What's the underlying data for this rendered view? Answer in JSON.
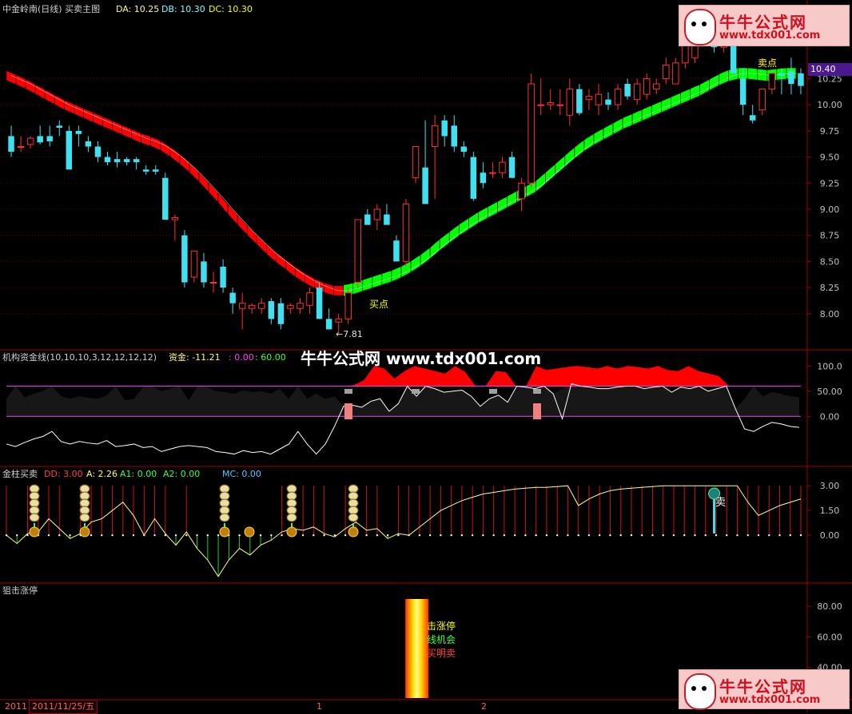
{
  "header": {
    "title": "中金岭南(日线) 买卖主图",
    "da": "DA: 10.25",
    "db": "DB: 10.30",
    "dc": "DC: 10.30"
  },
  "watermark": "牛牛公式网 www.tdx001.com",
  "logo": {
    "title": "牛牛公式网",
    "url": "www.tdx001.com"
  },
  "colors": {
    "up": "#ff3030",
    "down": "#40e0f0",
    "red_band": "#ff0000",
    "green_band": "#00ff00",
    "grid": "#800000",
    "axis_text": "#c0c0c0"
  },
  "annotations": {
    "buy": "买点",
    "sell": "卖点",
    "low": "←7.81"
  },
  "current_price": "10.40",
  "panel2": {
    "title": "机构资金线(10,10,10,3,12,12,12,12)",
    "fund": "资金: -11.21",
    "v1": ": 0.00",
    "v2": ": 60.00"
  },
  "panel3": {
    "title": "金柱买卖",
    "dd": "DD: 3.00",
    "a": "A: 2.26",
    "a1": "A1: 0.00",
    "a2": "A2: 0.00",
    "mc": "MC: 0.00",
    "sell_mark": "卖"
  },
  "panel4": {
    "title": "狙击涨停",
    "line1": "击涨停",
    "line2": "线机会",
    "line3": "买明卖"
  },
  "bottom": {
    "year": "2011",
    "date": "2011/11/25/五",
    "tick1": "1",
    "tick2": "2"
  },
  "chart_data": [
    {
      "type": "candlestick",
      "title": "中金岭南(日线) 买卖主图",
      "ylim": [
        7.7,
        10.85
      ],
      "yticks": [
        "10.25",
        "10.00",
        "9.75",
        "9.50",
        "9.25",
        "9.00",
        "8.75",
        "8.50",
        "8.25",
        "8.00"
      ],
      "candles": [
        [
          9.7,
          9.8,
          9.5,
          9.55
        ],
        [
          9.6,
          9.7,
          9.55,
          9.6
        ],
        [
          9.62,
          9.7,
          9.58,
          9.68
        ],
        [
          9.7,
          9.8,
          9.62,
          9.64
        ],
        [
          9.7,
          9.8,
          9.6,
          9.65
        ],
        [
          9.8,
          9.85,
          9.7,
          9.78
        ],
        [
          9.75,
          9.8,
          9.4,
          9.38
        ],
        [
          9.75,
          9.8,
          9.6,
          9.72
        ],
        [
          9.65,
          9.7,
          9.55,
          9.6
        ],
        [
          9.6,
          9.65,
          9.45,
          9.5
        ],
        [
          9.5,
          9.55,
          9.42,
          9.45
        ],
        [
          9.48,
          9.55,
          9.4,
          9.45
        ],
        [
          9.48,
          9.5,
          9.42,
          9.45
        ],
        [
          9.48,
          9.5,
          9.38,
          9.45
        ],
        [
          9.38,
          9.42,
          9.33,
          9.36
        ],
        [
          9.38,
          9.42,
          9.33,
          9.36
        ],
        [
          9.3,
          9.35,
          8.9,
          8.9
        ],
        [
          8.9,
          8.95,
          8.7,
          8.92
        ],
        [
          8.75,
          8.8,
          8.25,
          8.3
        ],
        [
          8.35,
          8.6,
          8.3,
          8.6
        ],
        [
          8.5,
          8.58,
          8.25,
          8.3
        ],
        [
          8.3,
          8.4,
          8.2,
          8.3
        ],
        [
          8.45,
          8.52,
          8.2,
          8.25
        ],
        [
          8.2,
          8.25,
          8.0,
          8.1
        ],
        [
          8.05,
          8.2,
          7.85,
          8.1
        ],
        [
          8.05,
          8.1,
          8.0,
          8.08
        ],
        [
          8.05,
          8.15,
          8.0,
          8.1
        ],
        [
          8.12,
          8.15,
          7.9,
          7.95
        ],
        [
          8.1,
          8.15,
          7.85,
          7.9
        ],
        [
          8.05,
          8.1,
          8.0,
          8.08
        ],
        [
          8.05,
          8.15,
          8.0,
          8.1
        ],
        [
          8.08,
          8.25,
          8.0,
          8.2
        ],
        [
          8.25,
          8.3,
          7.95,
          7.95
        ],
        [
          7.95,
          8.05,
          7.85,
          7.85
        ],
        [
          7.92,
          8.0,
          7.81,
          7.95
        ],
        [
          7.95,
          8.25,
          7.9,
          8.2
        ],
        [
          8.3,
          8.9,
          8.25,
          8.9
        ],
        [
          8.95,
          9.0,
          8.85,
          8.85
        ],
        [
          8.9,
          9.05,
          8.8,
          9.0
        ],
        [
          8.95,
          9.05,
          8.85,
          8.85
        ],
        [
          8.7,
          8.75,
          8.5,
          8.5
        ],
        [
          8.5,
          9.1,
          8.45,
          9.05
        ],
        [
          9.3,
          9.6,
          9.25,
          9.6
        ],
        [
          9.4,
          9.85,
          9.05,
          9.05
        ],
        [
          9.6,
          9.9,
          9.1,
          9.8
        ],
        [
          9.85,
          9.9,
          9.6,
          9.7
        ],
        [
          9.8,
          9.9,
          9.55,
          9.6
        ],
        [
          9.6,
          9.65,
          9.5,
          9.55
        ],
        [
          9.5,
          9.55,
          9.08,
          9.1
        ],
        [
          9.35,
          9.45,
          9.2,
          9.25
        ],
        [
          9.35,
          9.45,
          9.3,
          9.35
        ],
        [
          9.35,
          9.5,
          9.3,
          9.45
        ],
        [
          9.5,
          9.55,
          9.3,
          9.3
        ],
        [
          9.1,
          9.3,
          8.98,
          9.25
        ],
        [
          9.25,
          10.3,
          9.2,
          10.2
        ],
        [
          10.0,
          10.25,
          9.9,
          10.0
        ],
        [
          10.0,
          10.15,
          9.95,
          10.02
        ],
        [
          10.0,
          10.15,
          9.9,
          10.0
        ],
        [
          9.9,
          10.25,
          9.8,
          10.15
        ],
        [
          10.15,
          10.2,
          9.9,
          9.92
        ],
        [
          10.05,
          10.15,
          9.95,
          10.08
        ],
        [
          10.0,
          10.2,
          9.9,
          10.1
        ],
        [
          10.05,
          10.12,
          9.95,
          10.0
        ],
        [
          10.0,
          10.2,
          9.95,
          10.15
        ],
        [
          10.2,
          10.25,
          10.05,
          10.08
        ],
        [
          10.05,
          10.25,
          10.0,
          10.2
        ],
        [
          10.1,
          10.3,
          10.05,
          10.25
        ],
        [
          10.15,
          10.25,
          10.1,
          10.2
        ],
        [
          10.25,
          10.45,
          10.2,
          10.38
        ],
        [
          10.2,
          10.45,
          10.2,
          10.4
        ],
        [
          10.4,
          10.75,
          10.35,
          10.7
        ],
        [
          10.45,
          10.75,
          10.4,
          10.7
        ],
        [
          10.75,
          10.85,
          10.7,
          10.7
        ],
        [
          10.7,
          10.8,
          10.5,
          10.55
        ],
        [
          10.55,
          10.85,
          10.5,
          10.75
        ],
        [
          10.7,
          10.78,
          10.3,
          10.3
        ],
        [
          10.25,
          10.35,
          9.9,
          10.0
        ],
        [
          9.9,
          10.0,
          9.82,
          9.85
        ],
        [
          9.95,
          10.15,
          9.9,
          10.15
        ],
        [
          10.15,
          10.3,
          10.1,
          10.3
        ],
        [
          10.3,
          10.35,
          10.1,
          10.28
        ],
        [
          10.32,
          10.45,
          10.1,
          10.2
        ],
        [
          10.3,
          10.35,
          10.1,
          10.18
        ]
      ],
      "ma_band": [
        10.28,
        10.24,
        10.2,
        10.15,
        10.1,
        10.05,
        10.0,
        9.96,
        9.92,
        9.88,
        9.84,
        9.8,
        9.76,
        9.72,
        9.68,
        9.65,
        9.61,
        9.55,
        9.48,
        9.4,
        9.31,
        9.21,
        9.11,
        9.0,
        8.9,
        8.8,
        8.71,
        8.62,
        8.54,
        8.47,
        8.4,
        8.34,
        8.29,
        8.25,
        8.22,
        8.22,
        8.24,
        8.27,
        8.3,
        8.33,
        8.36,
        8.4,
        8.45,
        8.51,
        8.58,
        8.66,
        8.73,
        8.8,
        8.86,
        8.92,
        8.97,
        9.02,
        9.07,
        9.12,
        9.17,
        9.22,
        9.3,
        9.38,
        9.46,
        9.54,
        9.61,
        9.67,
        9.72,
        9.77,
        9.82,
        9.86,
        9.9,
        9.94,
        9.98,
        10.02,
        10.06,
        10.1,
        10.14,
        10.19,
        10.24,
        10.28,
        10.3,
        10.3,
        10.29,
        10.28,
        10.29,
        10.3,
        10.3
      ],
      "band_color_switch_index": 35
    },
    {
      "type": "line",
      "title": "机构资金线(10,10,10,3,12,12,12,12)",
      "ylim": [
        -90,
        110
      ],
      "yticks": [
        "100.0",
        "50.00",
        "0.00"
      ],
      "levels": [
        60,
        0
      ],
      "white_line": [
        -55,
        -60,
        -52,
        -45,
        -40,
        -30,
        -50,
        -55,
        -50,
        -53,
        -55,
        -48,
        -60,
        -58,
        -55,
        -62,
        -60,
        -70,
        -65,
        -60,
        -58,
        -60,
        -62,
        -70,
        -72,
        -75,
        -68,
        -72,
        -70,
        -75,
        -65,
        -55,
        -30,
        -55,
        -75,
        -55,
        -20,
        20,
        22,
        18,
        30,
        35,
        10,
        25,
        60,
        40,
        60,
        55,
        48,
        50,
        52,
        40,
        20,
        35,
        42,
        28,
        60,
        58,
        55,
        60,
        45,
        -5,
        65,
        60,
        58,
        55,
        55,
        58,
        60,
        60,
        55,
        58,
        60,
        48,
        58,
        55,
        60,
        50,
        55,
        60,
        15,
        -25,
        -30,
        -20,
        -12,
        -15,
        -20,
        -22
      ],
      "red_area_top": [
        60,
        62,
        72,
        100,
        95,
        75,
        90,
        100,
        95,
        90,
        85,
        100,
        88,
        60,
        60,
        90,
        88,
        60,
        60,
        100,
        92,
        95,
        98,
        100,
        98,
        95,
        100,
        95,
        100,
        98,
        95,
        100,
        92,
        90,
        100,
        90,
        85,
        80,
        60
      ]
    },
    {
      "type": "line",
      "title": "金柱买卖",
      "ylim": [
        -2.8,
        3.3
      ],
      "yticks": [
        "3.00",
        "1.50",
        "0.00"
      ],
      "yellow_line": [
        0.0,
        -0.5,
        0.1,
        0.2,
        1.0,
        0.4,
        -0.2,
        0.1,
        0.8,
        1.0,
        1.5,
        2.0,
        1.2,
        0.0,
        1.0,
        0.1,
        -0.6,
        0.2,
        -0.8,
        -1.5,
        -2.5,
        -1.5,
        -0.8,
        -1.2,
        -0.6,
        -0.3,
        0.2,
        0.4,
        0.3,
        0.5,
        0.1,
        -0.1,
        0.4,
        0.8,
        0.3,
        0.4,
        -0.2,
        0.1,
        0.0,
        0.5,
        1.0,
        1.5,
        1.8,
        2.1,
        2.3,
        2.5,
        2.6,
        2.7,
        2.8,
        2.85,
        2.9,
        2.9,
        2.95,
        3.0,
        1.8,
        2.2,
        2.5,
        2.7,
        2.8,
        2.85,
        2.9,
        2.95,
        3.0,
        3.0,
        3.0,
        3.0,
        3.0,
        3.0,
        3.0,
        3.0,
        2.0,
        1.2,
        1.5,
        1.8,
        2.0,
        2.2
      ],
      "buy_signal_positions": [
        0.05,
        0.14,
        0.39,
        0.51,
        0.62
      ],
      "sell_signal_position": 0.89
    },
    {
      "type": "bar",
      "title": "狙击涨停",
      "ylim": [
        20,
        90
      ],
      "yticks": [
        "80.00",
        "60.00",
        "40.00"
      ],
      "highlight_bar_position": 0.52
    }
  ]
}
